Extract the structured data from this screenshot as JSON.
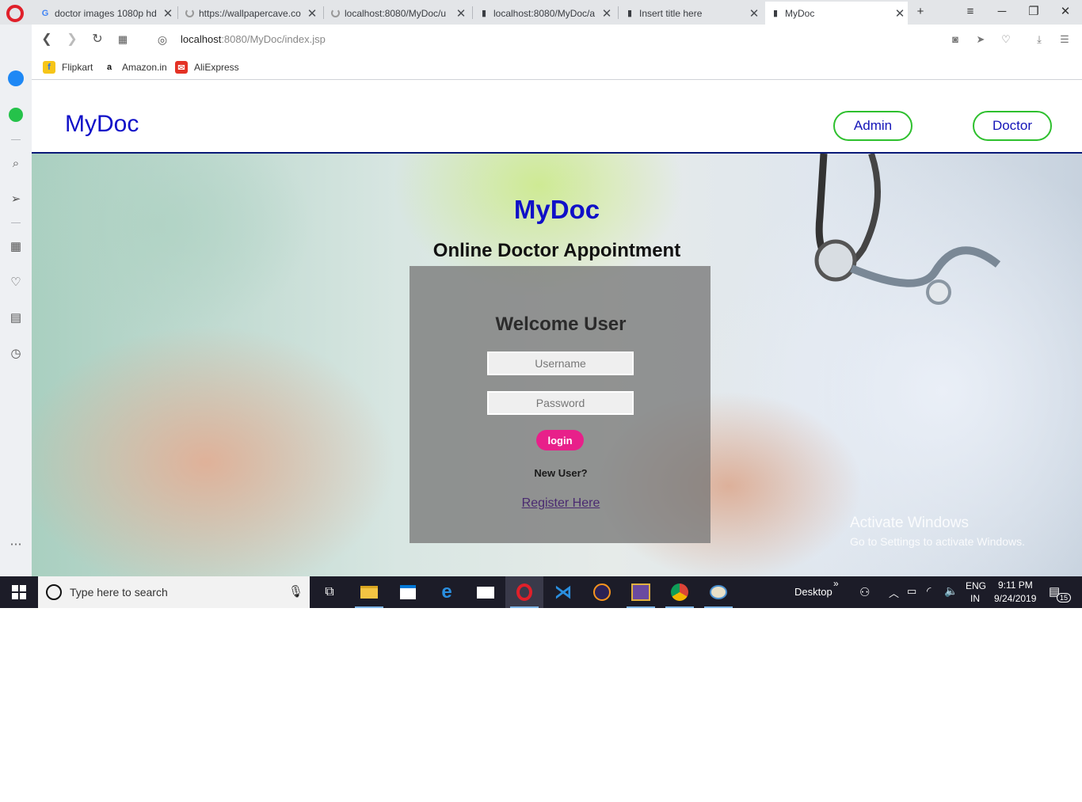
{
  "browser": {
    "tabs": [
      {
        "title": "doctor images 1080p hd",
        "icon": "google-icon"
      },
      {
        "title": "https://wallpapercave.co",
        "icon": "loading-icon"
      },
      {
        "title": "localhost:8080/MyDoc/u",
        "icon": "loading-icon"
      },
      {
        "title": "localhost:8080/MyDoc/a",
        "icon": "page-icon"
      },
      {
        "title": "Insert title here",
        "icon": "page-icon"
      },
      {
        "title": "MyDoc",
        "icon": "page-icon",
        "active": true
      }
    ],
    "url_host": "localhost",
    "url_rest": ":8080/MyDoc/index.jsp",
    "bookmarks": [
      "Flipkart",
      "Amazon.in",
      "AliExpress"
    ]
  },
  "site": {
    "brand": "MyDoc",
    "nav": {
      "admin": "Admin",
      "doctor": "Doctor"
    },
    "hero_title": "MyDoc",
    "hero_subtitle": "Online Doctor Appointment",
    "login": {
      "heading": "Welcome User",
      "username_placeholder": "Username",
      "password_placeholder": "Password",
      "button": "login",
      "new_user": "New User?",
      "register": "Register Here"
    },
    "watermark": {
      "line1": "Activate Windows",
      "line2": "Go to Settings to activate Windows."
    }
  },
  "taskbar": {
    "search_placeholder": "Type here to search",
    "desktop_label": "Desktop",
    "lang_1": "ENG",
    "lang_2": "IN",
    "time": "9:11 PM",
    "date": "9/24/2019",
    "notification_count": "15"
  },
  "colors": {
    "brand_blue": "#1010c8",
    "nav_border_green": "#2ec02e",
    "login_button": "#e8208a",
    "header_rule": "#0a1a78"
  }
}
